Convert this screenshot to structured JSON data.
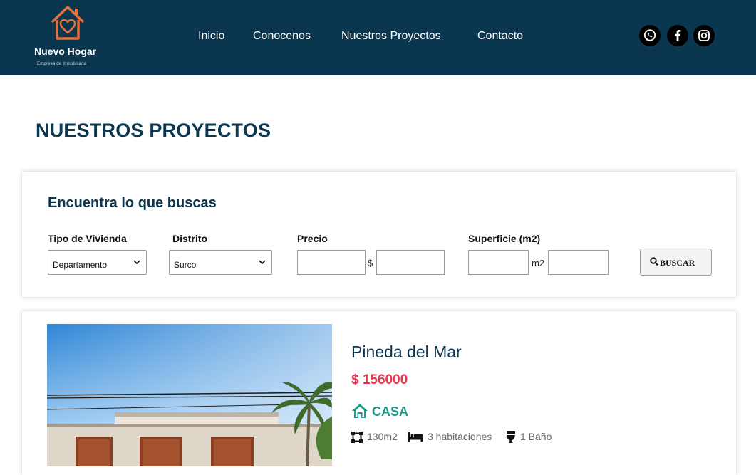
{
  "brand": {
    "name": "Nuevo Hogar",
    "tagline": "Empresa de Inmobiliaria",
    "accent": "#e8703a",
    "header_bg": "#0b364f"
  },
  "nav": {
    "items": [
      {
        "label": "Inicio"
      },
      {
        "label": "Conocenos"
      },
      {
        "label": "Nuestros Proyectos"
      },
      {
        "label": "Contacto"
      }
    ]
  },
  "social": [
    "whatsapp-icon",
    "facebook-icon",
    "instagram-icon"
  ],
  "page": {
    "title": "NUESTROS PROYECTOS"
  },
  "search": {
    "title": "Encuentra lo que buscas",
    "tipo_label": "Tipo de Vivienda",
    "tipo_value": "Departamento",
    "distrito_label": "Distrito",
    "distrito_value": "Surco",
    "precio_label": "Precio",
    "precio_unit": "$",
    "precio_min": "",
    "precio_max": "",
    "superficie_label": "Superficie (m2)",
    "superficie_unit": "m2",
    "superficie_min": "",
    "superficie_max": "",
    "button_label": "BUSCAR"
  },
  "project": {
    "name": "Pineda del Mar",
    "price": "$ 156000",
    "type": "CASA",
    "area": "130m2",
    "rooms": "3 habitaciones",
    "baths": "1 Baño",
    "price_color": "#e8374f",
    "type_color": "#1a9a8a"
  }
}
